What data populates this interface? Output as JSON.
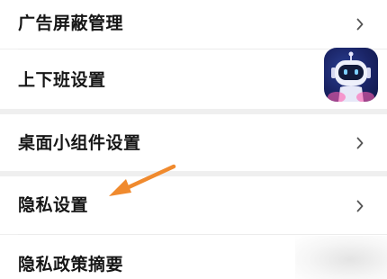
{
  "settings": {
    "items": [
      {
        "label": "广告屏蔽管理",
        "chevron": true
      },
      {
        "label": "上下班设置",
        "chevron": false
      },
      {
        "label": "桌面小组件设置",
        "chevron": true
      },
      {
        "label": "隐私设置",
        "chevron": true
      },
      {
        "label": "隐私政策摘要",
        "chevron": false
      }
    ]
  },
  "assistant_avatar": {
    "icon": "robot-icon"
  },
  "annotation": {
    "icon": "arrow-icon",
    "color": "#f08a2e"
  },
  "colors": {
    "background": "#efefef",
    "row": "#ffffff",
    "text": "#161616",
    "chevron": "#555555",
    "arrow": "#f08a2e"
  }
}
